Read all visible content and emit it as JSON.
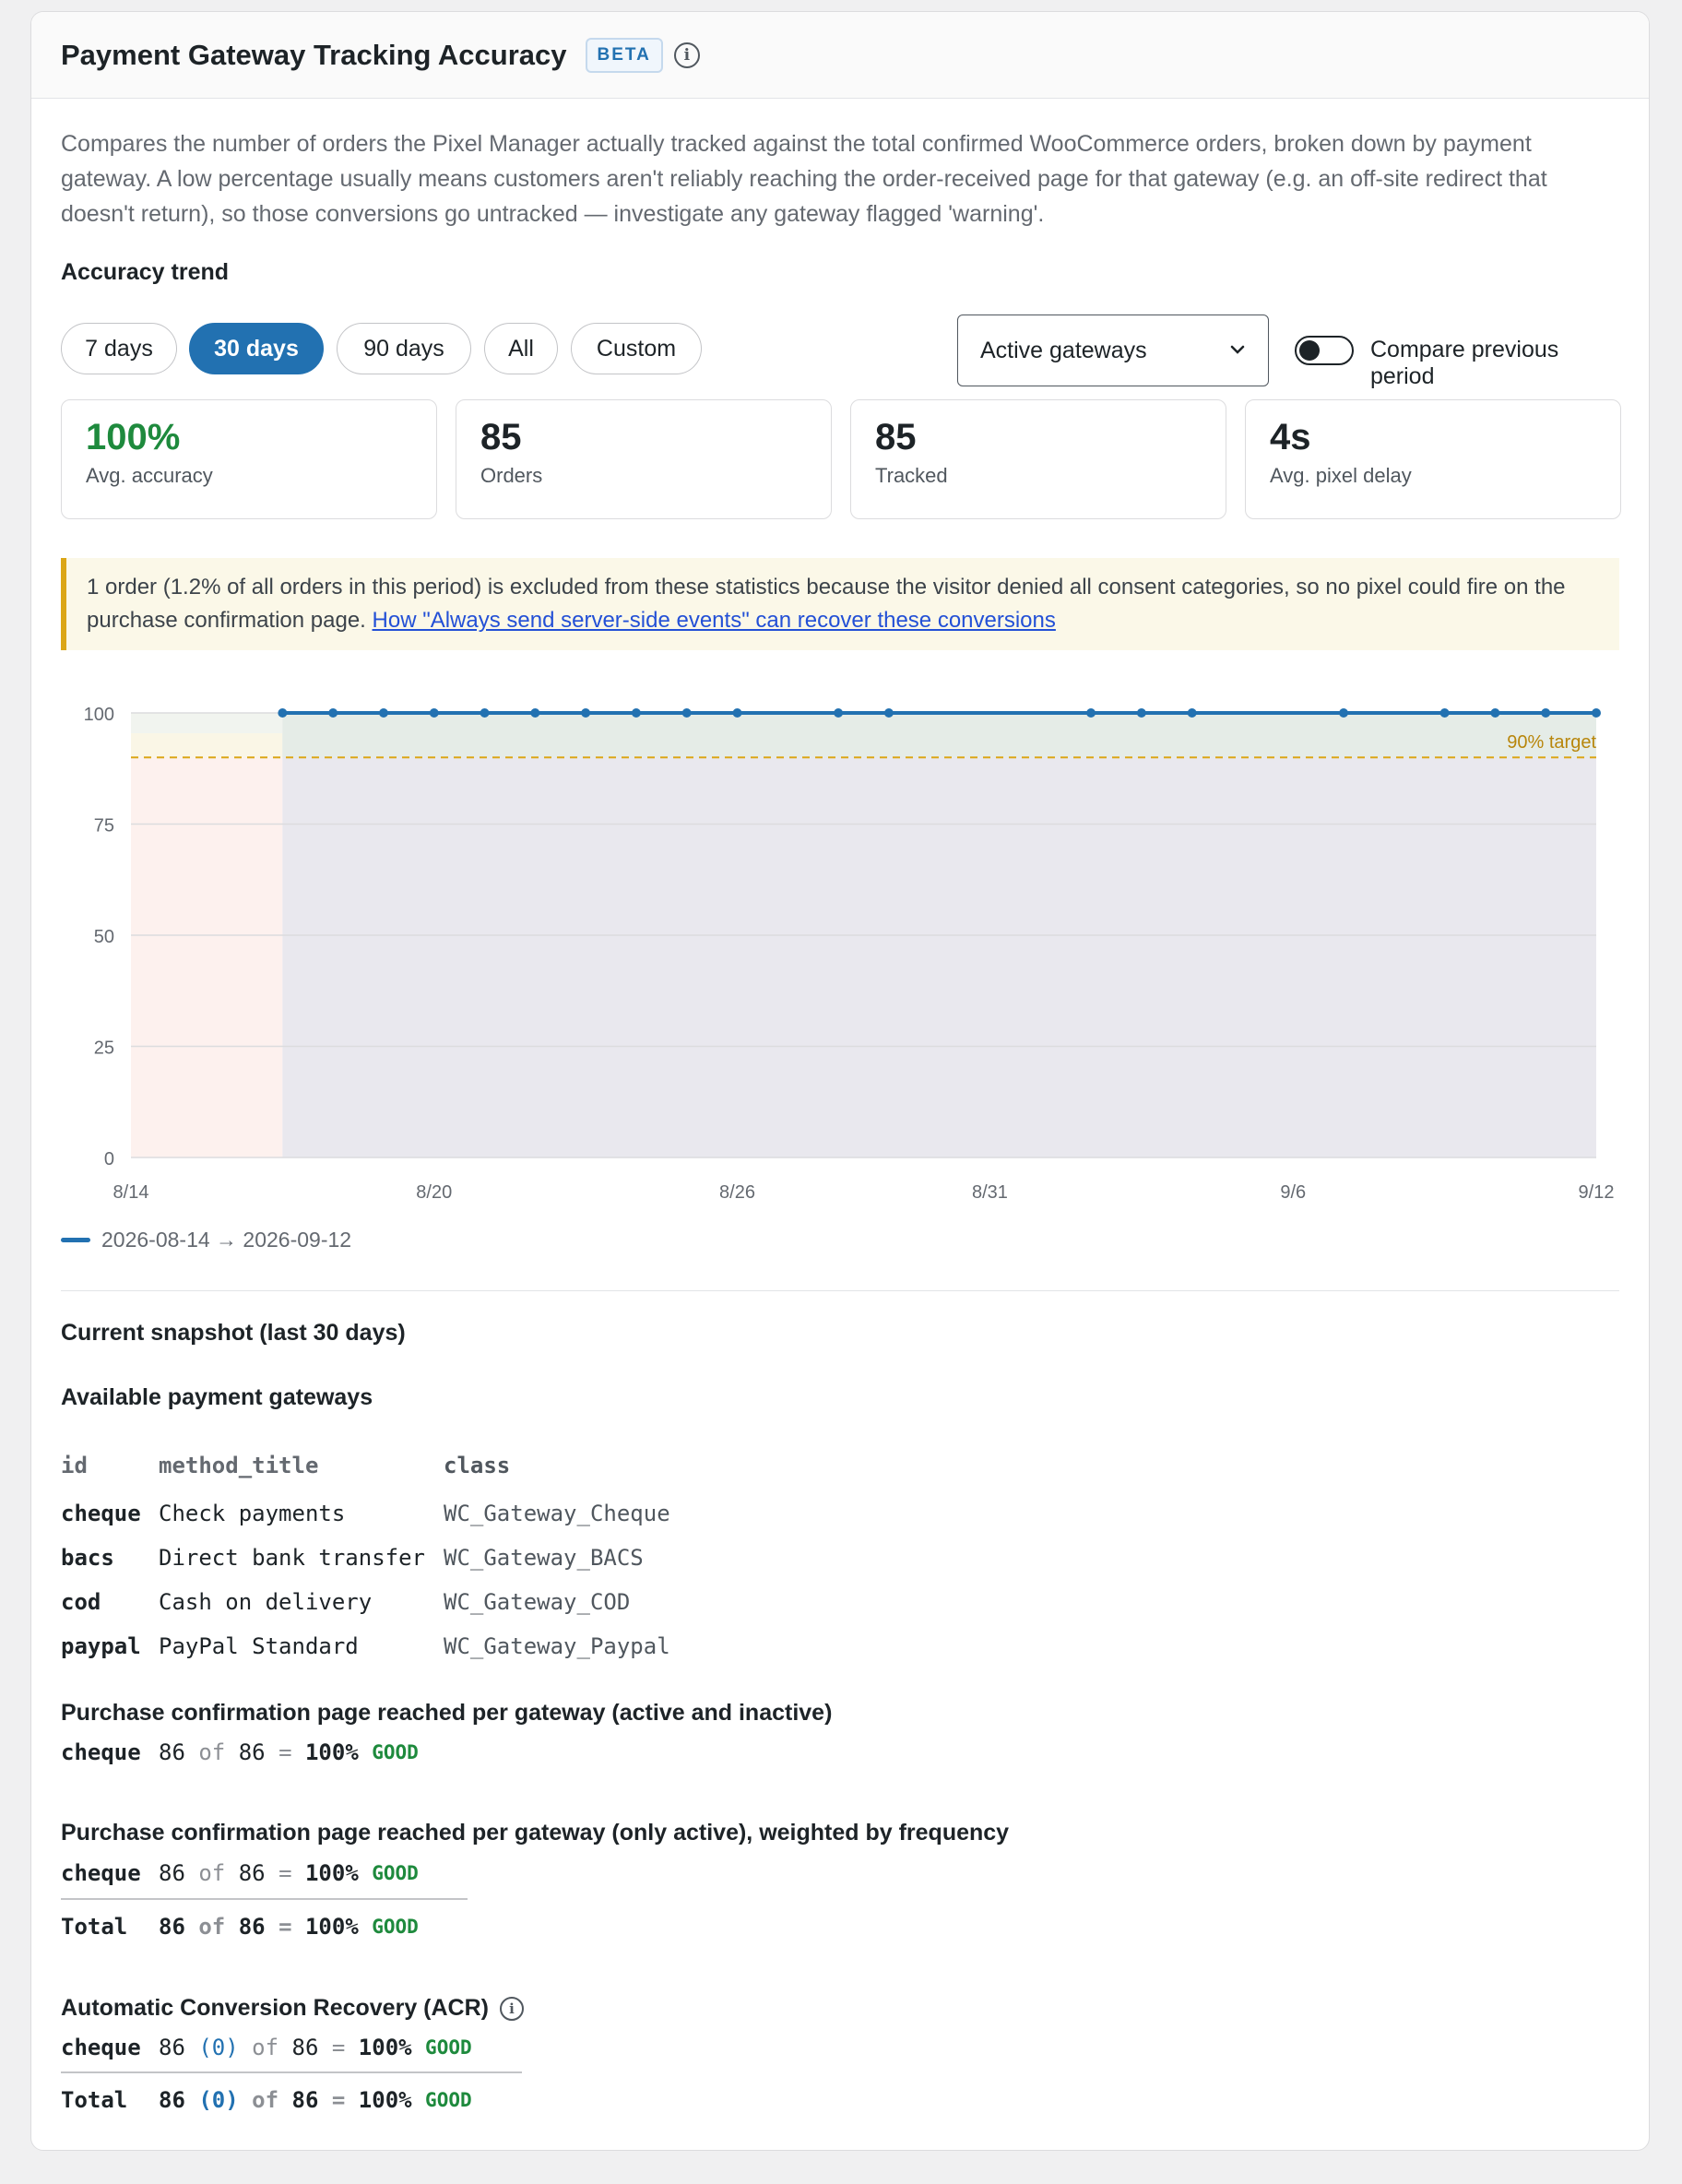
{
  "header": {
    "title": "Payment Gateway Tracking Accuracy",
    "badge": "BETA",
    "info_icon": "info-icon"
  },
  "description": "Compares the number of orders the Pixel Manager actually tracked against the total confirmed WooCommerce orders, broken down by payment gateway. A low percentage usually means customers aren't reliably reaching the order-received page for that gateway (e.g. an off-site redirect that doesn't return), so those conversions go untracked — investigate any gateway flagged 'warning'.",
  "trend": {
    "heading": "Accuracy trend",
    "ranges": [
      {
        "label": "7 days",
        "active": false
      },
      {
        "label": "30 days",
        "active": true
      },
      {
        "label": "90 days",
        "active": false
      },
      {
        "label": "All",
        "active": false
      },
      {
        "label": "Custom",
        "active": false
      }
    ],
    "select_value": "Active gateways",
    "compare_label": "Compare previous period",
    "compare_on": false
  },
  "stats": [
    {
      "value": "100%",
      "label": "Avg. accuracy",
      "highlight": true
    },
    {
      "value": "85",
      "label": "Orders",
      "highlight": false
    },
    {
      "value": "85",
      "label": "Tracked",
      "highlight": false
    },
    {
      "value": "4s",
      "label": "Avg. pixel delay",
      "highlight": false
    }
  ],
  "notice": {
    "text": "1 order (1.2% of all orders in this period) is excluded from these statistics because the visitor denied all consent categories, so no pixel could fire on the purchase confirmation page. ",
    "link": "How \"Always send server-side events\" can recover these conversions"
  },
  "chart_data": {
    "type": "line",
    "x_labels": [
      "8/14",
      "8/20",
      "8/26",
      "8/31",
      "9/6",
      "9/12"
    ],
    "x_label_days": [
      0,
      6,
      12,
      17,
      23,
      29
    ],
    "points_days": [
      3,
      4,
      5,
      6,
      7,
      8,
      9,
      10,
      11,
      12,
      14,
      15,
      19,
      20,
      21,
      24,
      26,
      27,
      28,
      29
    ],
    "points_value": 100,
    "ylim": [
      0,
      100
    ],
    "y_ticks": [
      0,
      25,
      50,
      75,
      100
    ],
    "target": 90,
    "target_label": "90% target",
    "no_data_until_day": 3,
    "series": [
      {
        "name": "2026-08-14 → 2026-09-12"
      }
    ],
    "colors": {
      "line": "#2271b1",
      "target": "#dba617",
      "nodata": "#fdf1ee",
      "fill": "#e9e8ee"
    }
  },
  "snapshot": {
    "heading": "Current snapshot (last 30 days)",
    "gateways_heading": "Available payment gateways",
    "gateway_columns": [
      "id",
      "method_title",
      "class"
    ],
    "gateways": [
      {
        "id": "cheque",
        "title": "Check payments",
        "class": "WC_Gateway_Cheque"
      },
      {
        "id": "bacs",
        "title": "Direct bank transfer",
        "class": "WC_Gateway_BACS"
      },
      {
        "id": "cod",
        "title": "Cash on delivery",
        "class": "WC_Gateway_COD"
      },
      {
        "id": "paypal",
        "title": "PayPal Standard",
        "class": "WC_Gateway_Paypal"
      }
    ],
    "all_heading": "Purchase confirmation page reached per gateway (active and inactive)",
    "all_row": {
      "id": "cheque",
      "num": "86",
      "of": "of",
      "den": "86",
      "eq": "=",
      "pct": "100%",
      "status": "GOOD"
    },
    "active_heading": "Purchase confirmation page reached per gateway (only active), weighted by frequency",
    "active_row": {
      "id": "cheque",
      "num": "86",
      "of": "of",
      "den": "86",
      "eq": "=",
      "pct": "100%",
      "status": "GOOD"
    },
    "active_total": {
      "id": "Total",
      "num": "86",
      "of": "of",
      "den": "86",
      "eq": "=",
      "pct": "100%",
      "status": "GOOD"
    },
    "acr_heading": "Automatic Conversion Recovery (ACR)",
    "acr_row": {
      "id": "cheque",
      "num": "86",
      "rec": "(0)",
      "of": "of",
      "den": "86",
      "eq": "=",
      "pct": "100%",
      "status": "GOOD"
    },
    "acr_total": {
      "id": "Total",
      "num": "86",
      "rec": "(0)",
      "of": "of",
      "den": "86",
      "eq": "=",
      "pct": "100%",
      "status": "GOOD"
    }
  }
}
